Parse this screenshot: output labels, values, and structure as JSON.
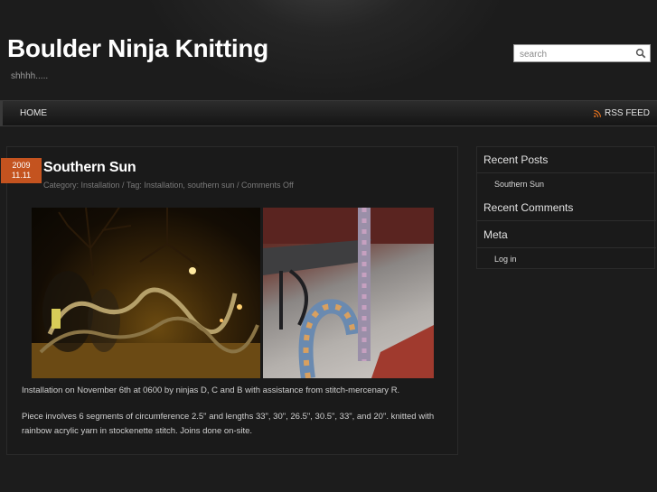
{
  "site": {
    "title": "Boulder Ninja Knitting",
    "tagline": "shhhh....."
  },
  "search": {
    "placeholder": "search"
  },
  "nav": {
    "home_label": "HOME",
    "rss_label": "RSS FEED"
  },
  "post": {
    "date_year": "2009",
    "date_monthday": "11.11",
    "title": "Southern Sun",
    "meta": "Category: Installation / Tag: Installation, southern sun / Comments Off",
    "paragraphs": [
      "Installation on November 6th at 0600 by ninjas D, C and B with assistance from stitch-mercenary R.",
      "Piece involves 6 segments of circumference 2.5\" and lengths 33\", 30\", 26.5\", 30.5\", 33\", and 20\". knitted with rainbow acrylic yarn in stockenette stitch. Joins done on-site."
    ]
  },
  "sidebar": {
    "recent_posts_title": "Recent Posts",
    "recent_posts": [
      "Southern Sun"
    ],
    "recent_comments_title": "Recent Comments",
    "meta_title": "Meta",
    "meta_links": [
      "Log in"
    ]
  },
  "colors": {
    "background": "#1c1c1c",
    "accent_date_badge": "#c4531f",
    "rss_orange": "#e8731e"
  },
  "icons": {
    "search": "magnifier-icon",
    "rss": "rss-icon"
  }
}
